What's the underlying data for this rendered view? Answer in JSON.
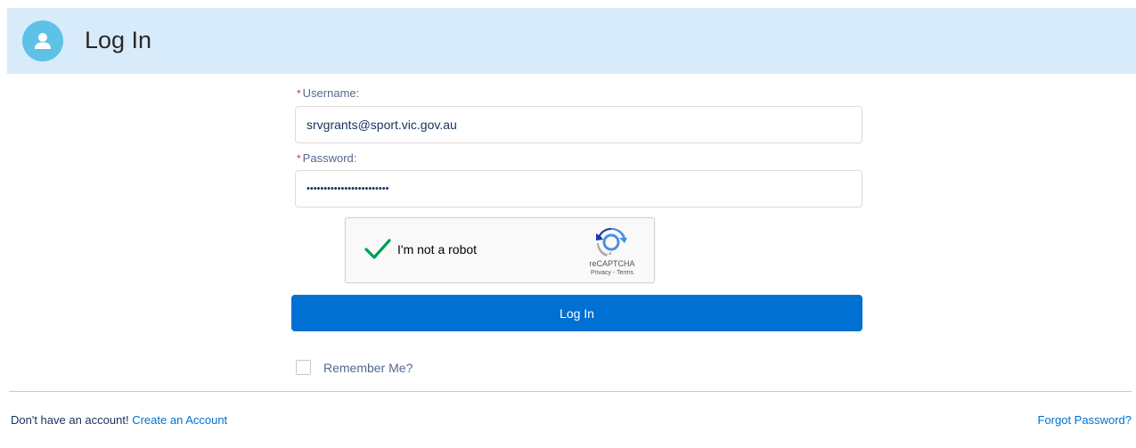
{
  "header": {
    "title": "Log In",
    "icon": "user-icon",
    "background_color": "#d8ebfb",
    "avatar_color": "#5ec1e6"
  },
  "form": {
    "username_label": "Username:",
    "username_value": "srvgrants@sport.vic.gov.au",
    "password_label": "Password:",
    "password_value": "••••••••••••••••••••••••",
    "required_marker": "*"
  },
  "captcha": {
    "label": "I'm not a robot",
    "checked": true,
    "brand": "reCAPTCHA",
    "links": "Privacy - Terms",
    "icon": "recaptcha-logo-icon"
  },
  "login_button": {
    "label": "Log In",
    "color": "#0070d2"
  },
  "remember": {
    "label": "Remember Me?",
    "checked": false
  },
  "footer": {
    "prompt": "Don't have an account!",
    "create_account": "Create an Account",
    "forgot_password": "Forgot Password?",
    "link_color": "#0070d2"
  }
}
